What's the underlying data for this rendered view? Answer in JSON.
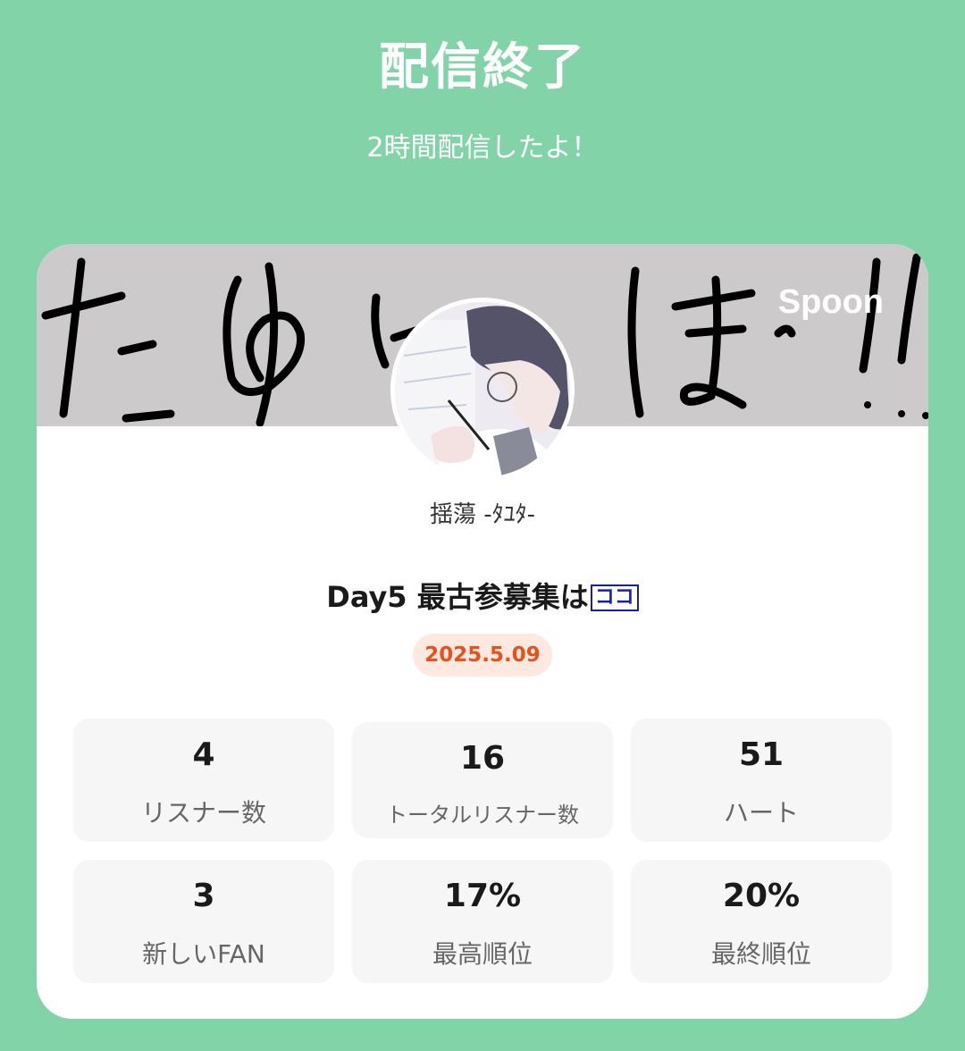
{
  "header": {
    "title": "配信終了",
    "subtitle": "2時間配信したよ！"
  },
  "banner": {
    "logo": "Spoon",
    "handwriting": "たゆと!ほ゜!!"
  },
  "profile": {
    "username": "揺蕩 -ﾀﾕﾀ-"
  },
  "live": {
    "title": "Day5 最古参募集は",
    "title_tag": "ココ",
    "date": "2025.5.09"
  },
  "stats": [
    {
      "value": "4",
      "label": "リスナー数"
    },
    {
      "value": "16",
      "label": "トータルリスナー数"
    },
    {
      "value": "51",
      "label": "ハート"
    },
    {
      "value": "3",
      "label": "新しいFAN"
    },
    {
      "value": "17%",
      "label": "最高順位"
    },
    {
      "value": "20%",
      "label": "最終順位"
    }
  ],
  "colors": {
    "background": "#82d4a8",
    "date_text": "#e5521e",
    "date_bg": "#fde9e0",
    "tag": "#1a1fa8"
  }
}
